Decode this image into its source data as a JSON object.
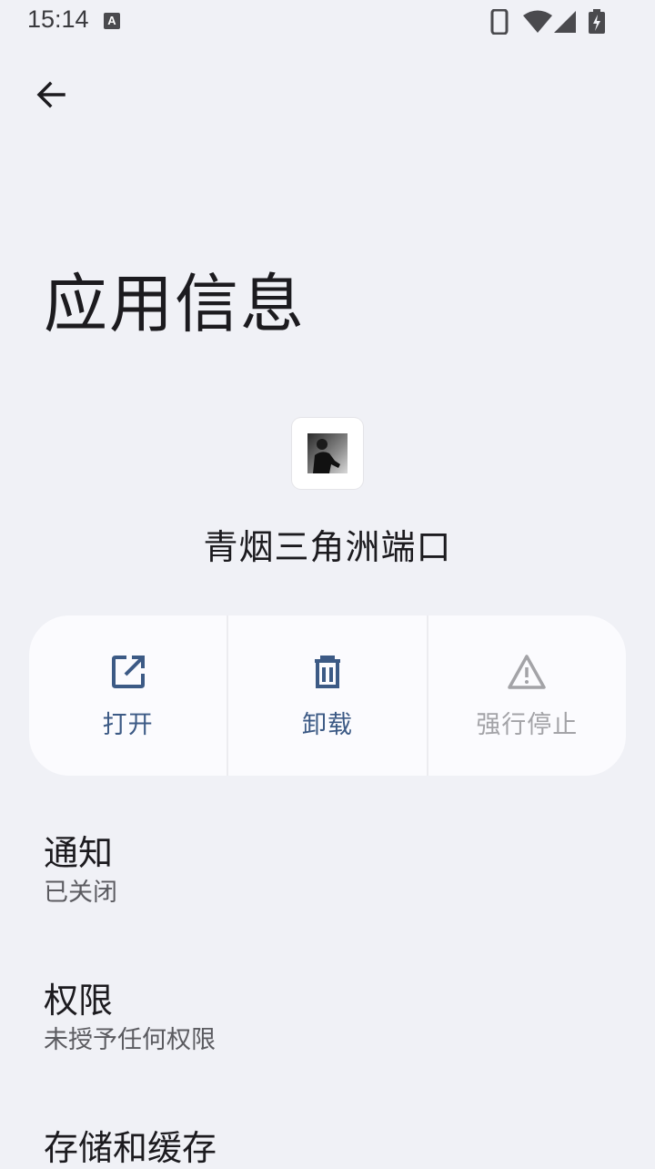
{
  "status_bar": {
    "time": "15:14",
    "ime_badge": "A",
    "icons": [
      "phone-icon",
      "wifi-icon",
      "signal-icon",
      "battery-charging-icon"
    ]
  },
  "header": {
    "back_icon": "arrow-back-icon",
    "title": "应用信息"
  },
  "app": {
    "name": "青烟三角洲端口",
    "icon": "app-icon-photo"
  },
  "actions": [
    {
      "label": "打开",
      "icon": "open-external-icon",
      "enabled": true
    },
    {
      "label": "卸载",
      "icon": "trash-icon",
      "enabled": true
    },
    {
      "label": "强行停止",
      "icon": "warning-icon",
      "enabled": false
    }
  ],
  "preferences": [
    {
      "title": "通知",
      "summary": "已关闭"
    },
    {
      "title": "权限",
      "summary": "未授予任何权限"
    },
    {
      "title": "存储和缓存",
      "summary": ""
    }
  ],
  "colors": {
    "background": "#f0f1f6",
    "card": "#fbfbfe",
    "accent": "#3c5a85",
    "disabled": "#a3a3a7"
  }
}
